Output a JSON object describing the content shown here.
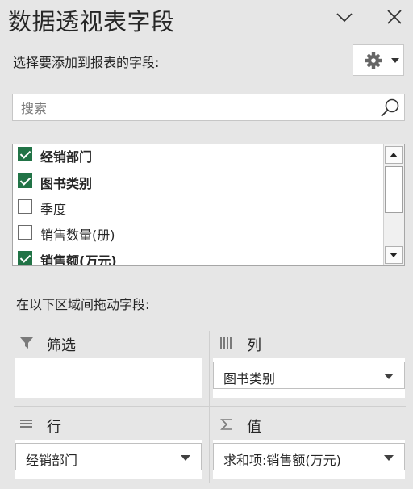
{
  "panel": {
    "title": "数据透视表字段",
    "choose_fields_label": "选择要添加到报表的字段:",
    "drag_fields_label": "在以下区域间拖动字段:"
  },
  "search": {
    "placeholder": "搜索",
    "value": ""
  },
  "fields": [
    {
      "label": "经销部门",
      "checked": true
    },
    {
      "label": "图书类别",
      "checked": true
    },
    {
      "label": "季度",
      "checked": false
    },
    {
      "label": "销售数量(册)",
      "checked": false
    },
    {
      "label": "销售额(万元)",
      "checked": true
    }
  ],
  "areas": {
    "filters": {
      "label": "筛选",
      "icon": "filter-icon",
      "items": []
    },
    "columns": {
      "label": "列",
      "icon": "columns-icon",
      "items": [
        "图书类别"
      ]
    },
    "rows": {
      "label": "行",
      "icon": "rows-icon",
      "items": [
        "经销部门"
      ]
    },
    "values": {
      "label": "值",
      "icon": "sigma-icon",
      "items": [
        "求和项:销售额(万元)"
      ]
    }
  },
  "colors": {
    "checked": "#217346",
    "background": "#e6e6e6"
  }
}
